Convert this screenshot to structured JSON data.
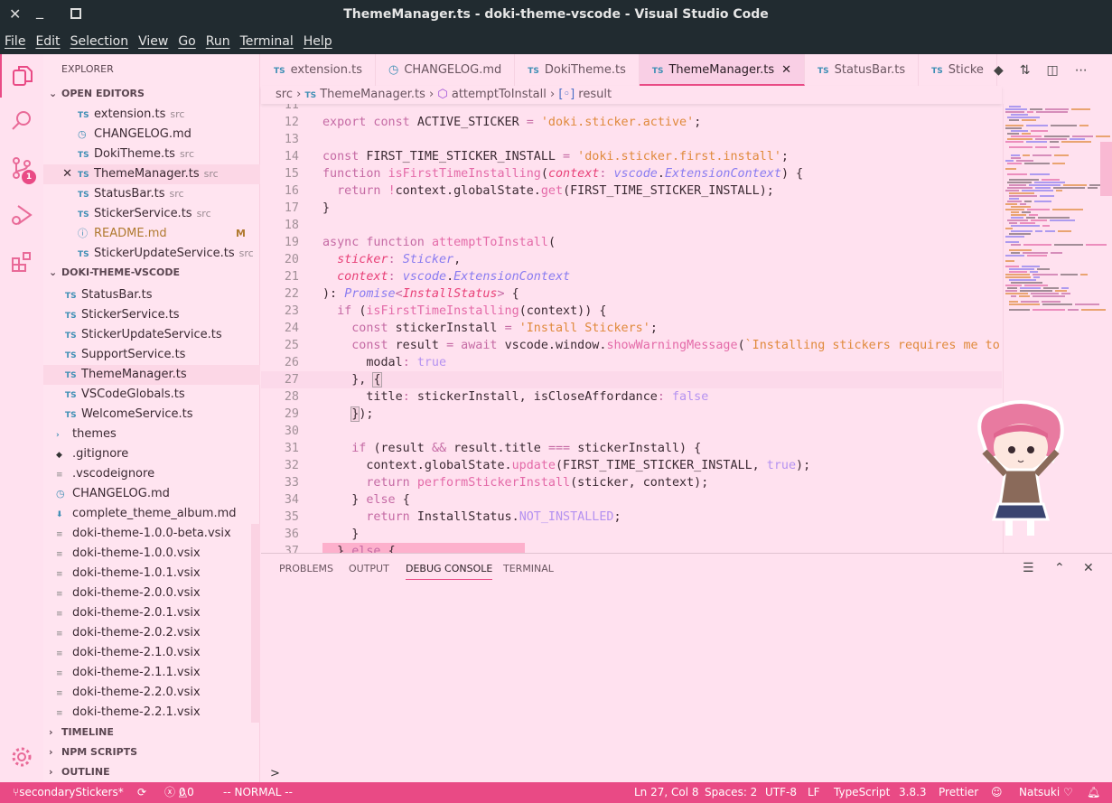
{
  "window": {
    "title": "ThemeManager.ts - doki-theme-vscode - Visual Studio Code"
  },
  "menu": [
    "File",
    "Edit",
    "Selection",
    "View",
    "Go",
    "Run",
    "Terminal",
    "Help"
  ],
  "activity": {
    "scm_badge": "1"
  },
  "sidebar": {
    "title": "EXPLORER",
    "open_editors_label": "OPEN EDITORS",
    "open_editors": [
      {
        "icon": "ts",
        "name": "extension.ts",
        "hint": "src"
      },
      {
        "icon": "md",
        "name": "CHANGELOG.md",
        "hint": ""
      },
      {
        "icon": "ts",
        "name": "DokiTheme.ts",
        "hint": "src"
      },
      {
        "icon": "ts",
        "name": "ThemeManager.ts",
        "hint": "src",
        "selected": true
      },
      {
        "icon": "ts",
        "name": "StatusBar.ts",
        "hint": "src"
      },
      {
        "icon": "ts",
        "name": "StickerService.ts",
        "hint": "src"
      },
      {
        "icon": "info",
        "name": "README.md",
        "hint": "",
        "badge": "M"
      },
      {
        "icon": "ts",
        "name": "StickerUpdateService.ts",
        "hint": "src"
      }
    ],
    "project_label": "DOKI-THEME-VSCODE",
    "files": [
      {
        "icon": "ts",
        "name": "StatusBar.ts",
        "indent": 1
      },
      {
        "icon": "ts",
        "name": "StickerService.ts",
        "indent": 1
      },
      {
        "icon": "ts",
        "name": "StickerUpdateService.ts",
        "indent": 1
      },
      {
        "icon": "ts",
        "name": "SupportService.ts",
        "indent": 1
      },
      {
        "icon": "ts",
        "name": "ThemeManager.ts",
        "indent": 1,
        "selected": true
      },
      {
        "icon": "ts",
        "name": "VSCodeGlobals.ts",
        "indent": 1
      },
      {
        "icon": "ts",
        "name": "WelcomeService.ts",
        "indent": 1
      },
      {
        "icon": "folder",
        "name": "themes",
        "indent": 0
      },
      {
        "icon": "git",
        "name": ".gitignore",
        "indent": 0
      },
      {
        "icon": "txt",
        "name": ".vscodeignore",
        "indent": 0
      },
      {
        "icon": "md",
        "name": "CHANGELOG.md",
        "indent": 0
      },
      {
        "icon": "dl",
        "name": "complete_theme_album.md",
        "indent": 0
      },
      {
        "icon": "txt",
        "name": "doki-theme-1.0.0-beta.vsix",
        "indent": 0
      },
      {
        "icon": "txt",
        "name": "doki-theme-1.0.0.vsix",
        "indent": 0
      },
      {
        "icon": "txt",
        "name": "doki-theme-1.0.1.vsix",
        "indent": 0
      },
      {
        "icon": "txt",
        "name": "doki-theme-2.0.0.vsix",
        "indent": 0
      },
      {
        "icon": "txt",
        "name": "doki-theme-2.0.1.vsix",
        "indent": 0
      },
      {
        "icon": "txt",
        "name": "doki-theme-2.0.2.vsix",
        "indent": 0
      },
      {
        "icon": "txt",
        "name": "doki-theme-2.1.0.vsix",
        "indent": 0
      },
      {
        "icon": "txt",
        "name": "doki-theme-2.1.1.vsix",
        "indent": 0
      },
      {
        "icon": "txt",
        "name": "doki-theme-2.2.0.vsix",
        "indent": 0
      },
      {
        "icon": "txt",
        "name": "doki-theme-2.2.1.vsix",
        "indent": 0
      }
    ],
    "bottom_sections": [
      "TIMELINE",
      "NPM SCRIPTS",
      "OUTLINE"
    ]
  },
  "tabs": [
    {
      "icon": "ts",
      "label": "extension.ts"
    },
    {
      "icon": "md",
      "label": "CHANGELOG.md"
    },
    {
      "icon": "ts",
      "label": "DokiTheme.ts"
    },
    {
      "icon": "ts",
      "label": "ThemeManager.ts",
      "active": true
    },
    {
      "icon": "ts",
      "label": "StatusBar.ts"
    },
    {
      "icon": "ts",
      "label": "Sticke"
    }
  ],
  "breadcrumb": {
    "folder": "src",
    "file": "ThemeManager.ts",
    "function": "attemptToInstall",
    "symbol": "result"
  },
  "code": {
    "current_line": 27,
    "lines": [
      {
        "n": "11",
        "t": []
      },
      {
        "n": "12",
        "t": [
          [
            "kw",
            "export const "
          ],
          [
            "pl",
            "ACTIVE_STICKER "
          ],
          [
            "kw",
            "= "
          ],
          [
            "str",
            "'doki.sticker.active'"
          ],
          [
            "pl",
            ";"
          ]
        ]
      },
      {
        "n": "13",
        "t": []
      },
      {
        "n": "14",
        "t": [
          [
            "kw",
            "const "
          ],
          [
            "pl",
            "FIRST_TIME_STICKER_INSTALL "
          ],
          [
            "kw",
            "= "
          ],
          [
            "str",
            "'doki.sticker.first.install'"
          ],
          [
            "pl",
            ";"
          ]
        ]
      },
      {
        "n": "15",
        "t": [
          [
            "kw",
            "function "
          ],
          [
            "fn",
            "isFirstTimeInstalling"
          ],
          [
            "pl",
            "("
          ],
          [
            "par",
            "context"
          ],
          [
            "kw",
            ": "
          ],
          [
            "ty",
            "vscode"
          ],
          [
            "pl",
            "."
          ],
          [
            "ty",
            "ExtensionContext"
          ],
          [
            "pl",
            ") {"
          ]
        ]
      },
      {
        "n": "16",
        "t": [
          [
            "pl",
            "  "
          ],
          [
            "kw",
            "return "
          ],
          [
            "fn",
            "!"
          ],
          [
            "pl",
            "context.globalState."
          ],
          [
            "fn",
            "get"
          ],
          [
            "pl",
            "(FIRST_TIME_STICKER_INSTALL);"
          ]
        ]
      },
      {
        "n": "17",
        "t": [
          [
            "pl",
            "}"
          ]
        ]
      },
      {
        "n": "18",
        "t": []
      },
      {
        "n": "19",
        "t": [
          [
            "kw",
            "async function "
          ],
          [
            "fn",
            "attemptToInstall"
          ],
          [
            "pl",
            "("
          ]
        ]
      },
      {
        "n": "20",
        "t": [
          [
            "pl",
            "  "
          ],
          [
            "par",
            "sticker"
          ],
          [
            "kw",
            ": "
          ],
          [
            "ty",
            "Sticker"
          ],
          [
            "pl",
            ","
          ]
        ]
      },
      {
        "n": "21",
        "t": [
          [
            "pl",
            "  "
          ],
          [
            "par",
            "context"
          ],
          [
            "kw",
            ": "
          ],
          [
            "ty",
            "vscode"
          ],
          [
            "pl",
            "."
          ],
          [
            "ty",
            "ExtensionContext"
          ]
        ]
      },
      {
        "n": "22",
        "t": [
          [
            "pl",
            "): "
          ],
          [
            "ty",
            "Promise"
          ],
          [
            "kw",
            "<"
          ],
          [
            "par",
            "InstallStatus"
          ],
          [
            "kw",
            "> "
          ],
          [
            "pl",
            "{"
          ]
        ]
      },
      {
        "n": "23",
        "t": [
          [
            "pl",
            "  "
          ],
          [
            "kw",
            "if "
          ],
          [
            "pl",
            "("
          ],
          [
            "fn",
            "isFirstTimeInstalling"
          ],
          [
            "pl",
            "(context)) {"
          ]
        ]
      },
      {
        "n": "24",
        "t": [
          [
            "pl",
            "    "
          ],
          [
            "kw",
            "const "
          ],
          [
            "pl",
            "stickerInstall "
          ],
          [
            "kw",
            "= "
          ],
          [
            "str",
            "'Install Stickers'"
          ],
          [
            "pl",
            ";"
          ]
        ]
      },
      {
        "n": "25",
        "t": [
          [
            "pl",
            "    "
          ],
          [
            "kw",
            "const "
          ],
          [
            "pl",
            "result "
          ],
          [
            "kw",
            "= await "
          ],
          [
            "pl",
            "vscode.window."
          ],
          [
            "fn",
            "showWarningMessage"
          ],
          [
            "pl",
            "("
          ],
          [
            "str",
            "`Installing stickers requires me to corrupt"
          ]
        ]
      },
      {
        "n": "26",
        "t": [
          [
            "pl",
            "      modal"
          ],
          [
            "kw",
            ": "
          ],
          [
            "cst",
            "true"
          ]
        ]
      },
      {
        "n": "27",
        "t": [
          [
            "pl",
            "    }, "
          ],
          [
            "bx",
            "{"
          ]
        ]
      },
      {
        "n": "28",
        "t": [
          [
            "pl",
            "      title"
          ],
          [
            "kw",
            ": "
          ],
          [
            "pl",
            "stickerInstall, isCloseAffordance"
          ],
          [
            "kw",
            ": "
          ],
          [
            "cst",
            "false"
          ]
        ]
      },
      {
        "n": "29",
        "t": [
          [
            "pl",
            "    "
          ],
          [
            "bx",
            "}"
          ],
          [
            "pl",
            ");"
          ]
        ]
      },
      {
        "n": "30",
        "t": []
      },
      {
        "n": "31",
        "t": [
          [
            "pl",
            "    "
          ],
          [
            "kw",
            "if "
          ],
          [
            "pl",
            "(result "
          ],
          [
            "kw",
            "&& "
          ],
          [
            "pl",
            "result.title "
          ],
          [
            "kw",
            "=== "
          ],
          [
            "pl",
            "stickerInstall) {"
          ]
        ]
      },
      {
        "n": "32",
        "t": [
          [
            "pl",
            "      context.globalState."
          ],
          [
            "fn",
            "update"
          ],
          [
            "pl",
            "(FIRST_TIME_STICKER_INSTALL, "
          ],
          [
            "cst",
            "true"
          ],
          [
            "pl",
            ");"
          ]
        ]
      },
      {
        "n": "33",
        "t": [
          [
            "pl",
            "      "
          ],
          [
            "kw",
            "return "
          ],
          [
            "fn",
            "performStickerInstall"
          ],
          [
            "pl",
            "(sticker, context);"
          ]
        ]
      },
      {
        "n": "34",
        "t": [
          [
            "pl",
            "    } "
          ],
          [
            "kw",
            "else "
          ],
          [
            "pl",
            "{"
          ]
        ]
      },
      {
        "n": "35",
        "t": [
          [
            "pl",
            "      "
          ],
          [
            "kw",
            "return "
          ],
          [
            "pl",
            "InstallStatus."
          ],
          [
            "cst",
            "NOT_INSTALLED"
          ],
          [
            "pl",
            ";"
          ]
        ]
      },
      {
        "n": "36",
        "t": [
          [
            "pl",
            "    }"
          ]
        ]
      },
      {
        "n": "37",
        "t": [
          [
            "pl",
            "  } "
          ],
          [
            "kw",
            "else "
          ],
          [
            "pl",
            "{"
          ]
        ]
      }
    ]
  },
  "panel": {
    "tabs": [
      "PROBLEMS",
      "OUTPUT",
      "DEBUG CONSOLE",
      "TERMINAL"
    ],
    "active": "DEBUG CONSOLE",
    "prompt": ">"
  },
  "statusbar": {
    "branch": "secondaryStickers*",
    "errors": "0",
    "warnings": "0",
    "mode": "-- NORMAL --",
    "position": "Ln 27, Col 8",
    "spaces": "Spaces: 2",
    "encoding": "UTF-8",
    "eol": "LF",
    "language": "TypeScript",
    "ts_version": "3.8.3",
    "formatter": "Prettier",
    "theme": "Natsuki ♡"
  },
  "colors": {
    "accent": "#e94a85",
    "titlebar": "#212b30",
    "background": "#ffe1ef",
    "active_tab": "#f9cfe5"
  }
}
